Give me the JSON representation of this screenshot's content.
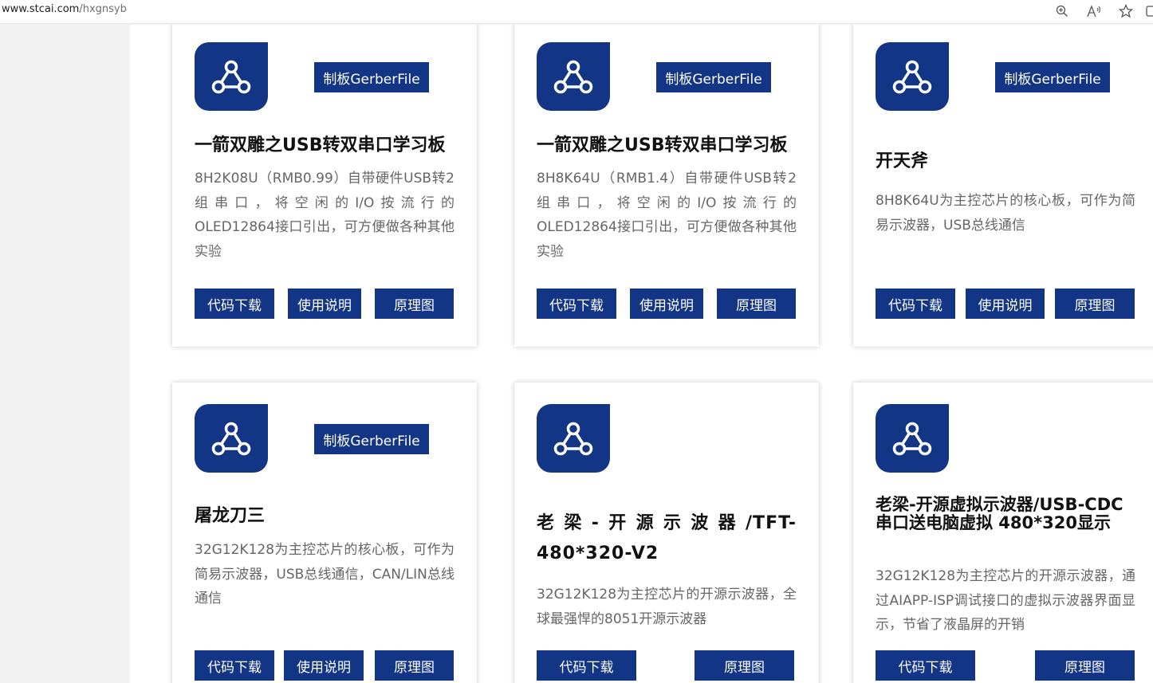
{
  "browser": {
    "url_host": "www.stcai.com",
    "url_path": "/hxgnsyb",
    "icons": [
      "zoom-icon",
      "read-aloud-icon",
      "favorite-star-icon",
      "collections-icon"
    ]
  },
  "colors": {
    "accent": "#133586",
    "text": "#111111",
    "muted": "#666666"
  },
  "cards": [
    {
      "gerber": "制板GerberFile",
      "title": "一箭双雕之USB转双串口学习板",
      "desc": "8H2K08U（RMB0.99）自带硬件USB转2组串口，将空闲的I/O按流行的OLED12864接口引出，可方便做各种其他实验",
      "buttons": [
        "代码下载",
        "使用说明",
        "原理图"
      ]
    },
    {
      "gerber": "制板GerberFile",
      "title": "一箭双雕之USB转双串口学习板",
      "desc": "8H8K64U（RMB1.4）自带硬件USB转2组串口，将空闲的I/O按流行的OLED12864接口引出，可方便做各种其他实验",
      "buttons": [
        "代码下载",
        "使用说明",
        "原理图"
      ]
    },
    {
      "gerber": "制板GerberFile",
      "title": "开天斧",
      "desc": "8H8K64U为主控芯片的核心板，可作为简易示波器，USB总线通信",
      "buttons": [
        "代码下载",
        "使用说明",
        "原理图"
      ]
    },
    {
      "gerber": "制板GerberFile",
      "title": "屠龙刀三",
      "desc": "32G12K128为主控芯片的核心板，可作为简易示波器，USB总线通信，CAN/LIN总线通信",
      "buttons": [
        "代码下载",
        "使用说明",
        "原理图"
      ]
    },
    {
      "title": "老梁-开源示波器/TFT-480*320-V2",
      "desc": "32G12K128为主控芯片的开源示波器，全球最强悍的8051开源示波器",
      "buttons": [
        "代码下载",
        "原理图"
      ]
    },
    {
      "title": "老梁-开源虚拟示波器/USB-CDC串口送电脑虚拟 480*320显示",
      "desc": "32G12K128为主控芯片的开源示波器，通过AIAPP-ISP调试接口的虚拟示波器界面显示，节省了液晶屏的开销",
      "buttons": [
        "代码下载",
        "原理图"
      ]
    }
  ]
}
